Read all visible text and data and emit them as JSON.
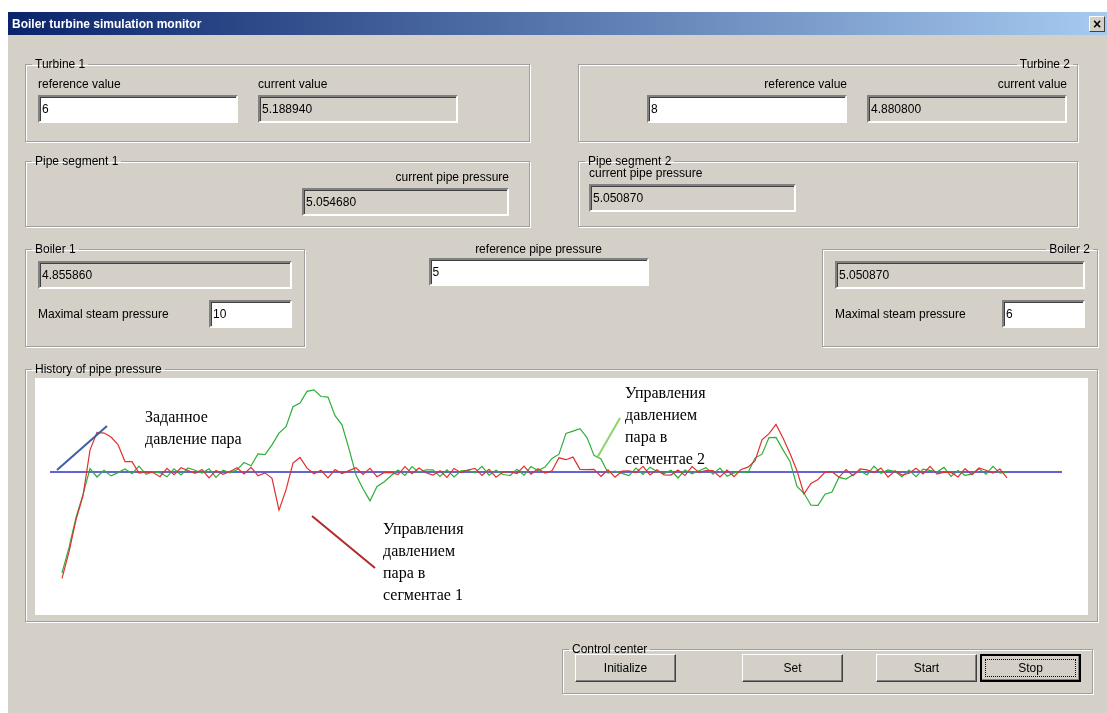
{
  "window": {
    "title": "Boiler turbine simulation monitor",
    "close": "×"
  },
  "turbines": [
    {
      "title": "Turbine 1",
      "reference_label": "reference value",
      "reference_value": "6",
      "current_label": "current value",
      "current_value": "5.188940"
    },
    {
      "title": "Turbine 2",
      "reference_label": "reference value",
      "reference_value": "8",
      "current_label": "current value",
      "current_value": "4.880800"
    }
  ],
  "pipe_segments": [
    {
      "title": "Pipe segment 1",
      "label": "current pipe pressure",
      "value": "5.054680"
    },
    {
      "title": "Pipe segment 2",
      "label": "current pipe pressure",
      "value": "5.050870"
    }
  ],
  "boilers": [
    {
      "title": "Boiler 1",
      "value": "4.855860",
      "max_label": "Maximal steam pressure",
      "max_value": "10"
    },
    {
      "title": "Boiler 2",
      "value": "5.050870",
      "max_label": "Maximal steam pressure",
      "max_value": "6"
    }
  ],
  "reference_pipe_pressure": {
    "label": "reference pipe pressure",
    "value": "5"
  },
  "history": {
    "title": "History of pipe pressure",
    "annotations": [
      {
        "kind": "reference",
        "text": "Заданное давление пара"
      },
      {
        "kind": "segment2",
        "text": "Управления давлением пара в сегментае 2"
      },
      {
        "kind": "segment1",
        "text": "Управления давлением пара в сегментае 1"
      }
    ]
  },
  "control_center": {
    "title": "Control center",
    "buttons": [
      {
        "label": "Initialize",
        "focused": false
      },
      {
        "label": "Set",
        "focused": false
      },
      {
        "label": "Start",
        "focused": false
      },
      {
        "label": "Stop",
        "focused": true
      }
    ]
  }
}
